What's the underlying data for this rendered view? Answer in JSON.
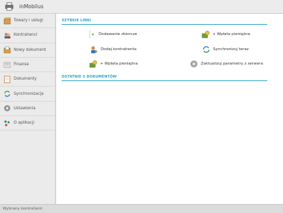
{
  "app": {
    "title": "inMobilus",
    "icon": "printer-icon"
  },
  "sidebar": {
    "items": [
      {
        "label": "Towary i usługi",
        "icon": "box-icon"
      },
      {
        "label": "Kontrahenci",
        "icon": "contacts-icon"
      },
      {
        "label": "Nowy dokument",
        "icon": "new-document-icon"
      },
      {
        "label": "Finanse",
        "icon": "finance-icon"
      },
      {
        "label": "Dokumenty",
        "icon": "documents-icon"
      },
      {
        "label": "Synchronizacja",
        "icon": "sync-icon"
      },
      {
        "label": "Ustawienia",
        "icon": "settings-icon"
      },
      {
        "label": "O aplikacji",
        "icon": "about-icon"
      }
    ]
  },
  "main": {
    "quick_links_header": "SZYBKIE LINKI",
    "quick_links": [
      {
        "label": "Dodawanie zbiorcze",
        "icon": "bulk-add-icon"
      },
      {
        "label": "+ Wpłata pieniężna",
        "icon": "cash-deposit-icon"
      },
      {
        "label": "Dodaj kontrahenta",
        "icon": "add-contractor-icon"
      },
      {
        "label": "Synchronizuj teraz",
        "icon": "sync-now-icon"
      },
      {
        "label": "+ Wpłata pieniężna",
        "icon": "cash-deposit-icon"
      },
      {
        "label": "Zaktualizuj parametry z serwera",
        "icon": "server-update-icon"
      }
    ],
    "recent_docs_header": "OSTATNIE 5 DOKUMENTÓW"
  },
  "status": {
    "label": "Wybrany kontrahent:"
  }
}
